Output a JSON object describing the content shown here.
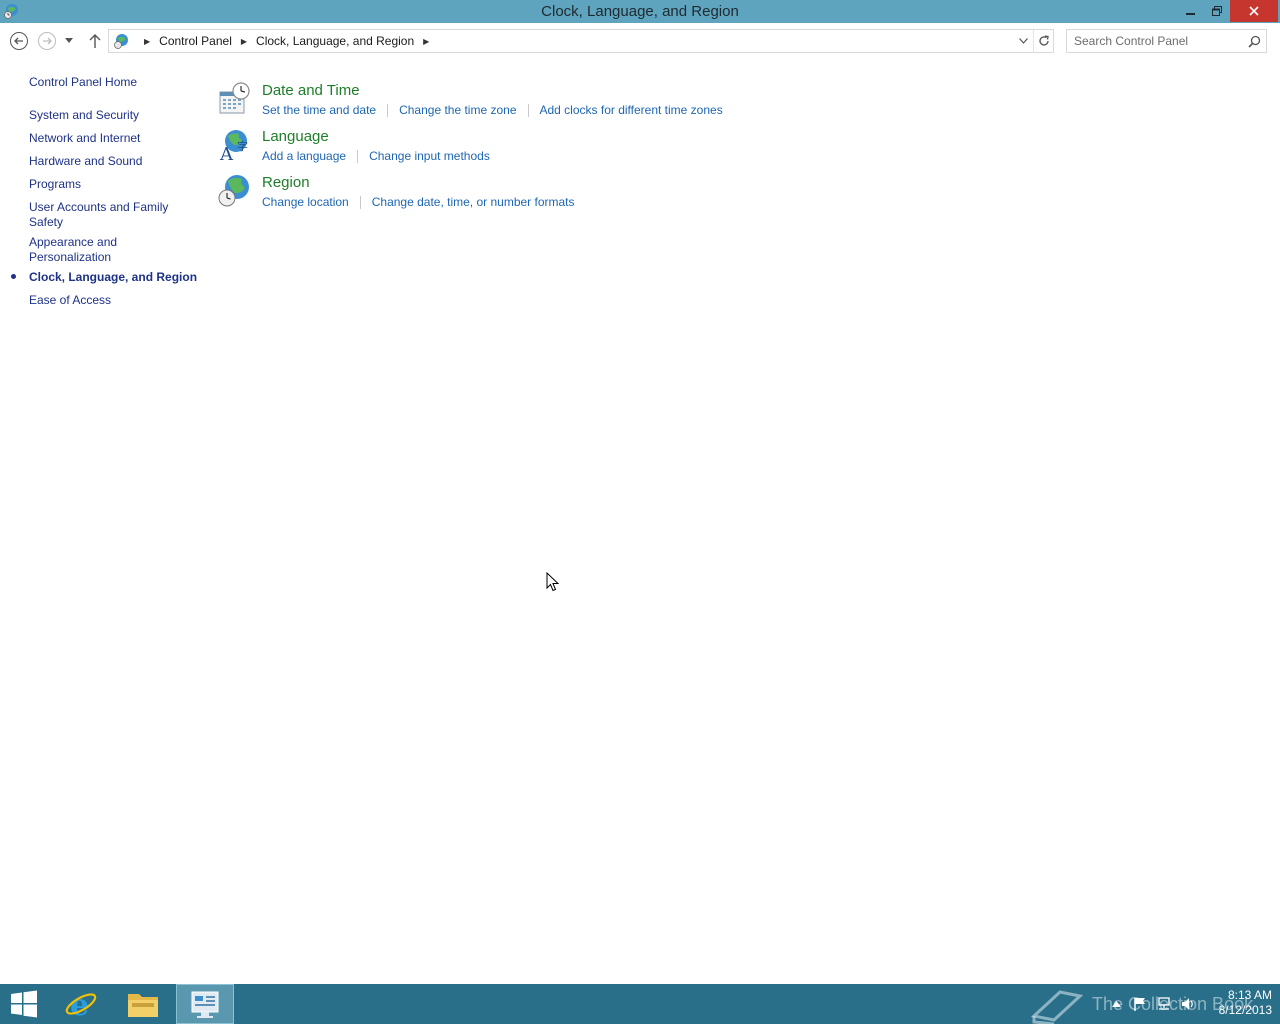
{
  "window": {
    "title": "Clock, Language, and Region"
  },
  "address": {
    "crumbs": [
      "Control Panel",
      "Clock, Language, and Region"
    ]
  },
  "search": {
    "placeholder": "Search Control Panel"
  },
  "left_nav": {
    "items": [
      {
        "label": "Control Panel Home"
      },
      {
        "label": "System and Security"
      },
      {
        "label": "Network and Internet"
      },
      {
        "label": "Hardware and Sound"
      },
      {
        "label": "Programs"
      },
      {
        "label": "User Accounts and Family Safety"
      },
      {
        "label": "Appearance and Personalization"
      },
      {
        "label": "Clock, Language, and Region",
        "current": true
      },
      {
        "label": "Ease of Access"
      }
    ]
  },
  "categories": [
    {
      "title": "Date and Time",
      "icon": "date-time-icon",
      "links": [
        "Set the time and date",
        "Change the time zone",
        "Add clocks for different time zones"
      ]
    },
    {
      "title": "Language",
      "icon": "language-icon",
      "links": [
        "Add a language",
        "Change input methods"
      ]
    },
    {
      "title": "Region",
      "icon": "region-globe-icon",
      "links": [
        "Change location",
        "Change date, time, or number formats"
      ]
    }
  ],
  "taskbar": {
    "watermark": "The Collection Book",
    "clock_time": "8:13 AM",
    "clock_date": "8/12/2013"
  },
  "colors": {
    "titlebar": "#5fa4bf",
    "close_button": "#c7362e",
    "taskbar": "#2a6f8a",
    "category_title": "#1e7e28",
    "task_link": "#1e66b4",
    "nav_link": "#1e3287"
  }
}
